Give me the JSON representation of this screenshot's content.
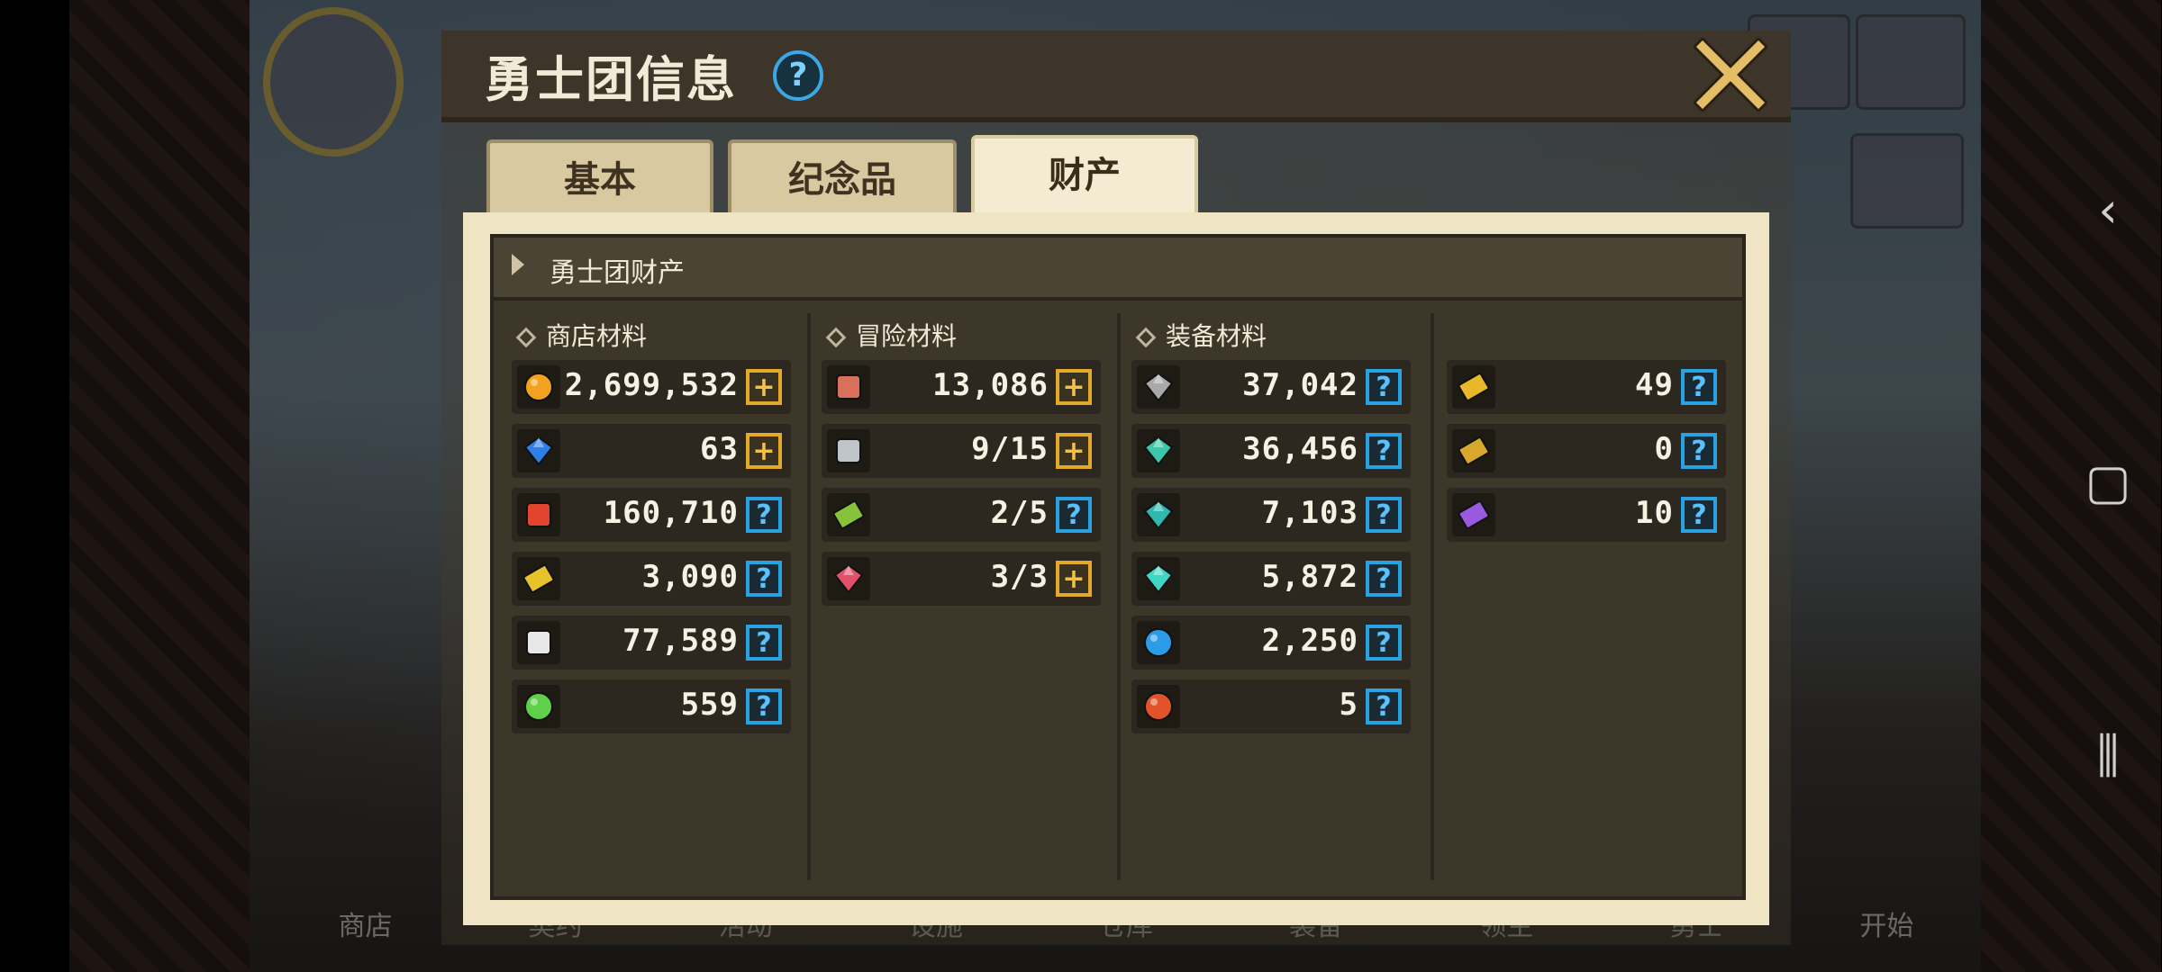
{
  "dialog": {
    "title": "勇士团信息",
    "help_glyph": "?",
    "close_icon": "close-icon"
  },
  "tabs": [
    {
      "label": "基本",
      "active": false
    },
    {
      "label": "纪念品",
      "active": false
    },
    {
      "label": "财产",
      "active": true
    }
  ],
  "panel": {
    "title": "勇士团财产"
  },
  "columns": [
    {
      "title": "商店材料",
      "items": [
        {
          "icon": "gold-coin-icon",
          "color": "#f2a21e",
          "value": "2,699,532",
          "action": "plus"
        },
        {
          "icon": "blue-gem-icon",
          "color": "#2f7fe8",
          "value": "63",
          "action": "plus"
        },
        {
          "icon": "star-medal-icon",
          "color": "#e2442e",
          "value": "160,710",
          "action": "help"
        },
        {
          "icon": "gold-ticket-icon",
          "color": "#e8c22a",
          "value": "3,090",
          "action": "help"
        },
        {
          "icon": "fish-bone-icon",
          "color": "#e8e8e8",
          "value": "77,589",
          "action": "help"
        },
        {
          "icon": "green-orb-icon",
          "color": "#5fd04a",
          "value": "559",
          "action": "help"
        }
      ]
    },
    {
      "title": "冒险材料",
      "items": [
        {
          "icon": "meat-icon",
          "color": "#d8705a",
          "value": "13,086",
          "action": "plus"
        },
        {
          "icon": "key-icon",
          "color": "#bfc4c8",
          "value": "9/15",
          "action": "plus"
        },
        {
          "icon": "green-ticket-icon",
          "color": "#86c23a",
          "value": "2/5",
          "action": "help"
        },
        {
          "icon": "red-crystal-icon",
          "color": "#e2506a",
          "value": "3/3",
          "action": "plus"
        }
      ]
    },
    {
      "title": "装备材料",
      "items": [
        {
          "icon": "iron-ore-icon",
          "color": "#a9a9a9",
          "value": "37,042",
          "action": "help"
        },
        {
          "icon": "teal-ore-icon",
          "color": "#3bc7a8",
          "value": "36,456",
          "action": "help"
        },
        {
          "icon": "teal-crystal-icon",
          "color": "#2fb7b0",
          "value": "7,103",
          "action": "help"
        },
        {
          "icon": "teal-gem-icon",
          "color": "#3fd6c6",
          "value": "5,872",
          "action": "help"
        },
        {
          "icon": "blue-orb-icon",
          "color": "#2a9ce8",
          "value": "2,250",
          "action": "help"
        },
        {
          "icon": "red-orb-icon",
          "color": "#e2532a",
          "value": "5",
          "action": "help"
        }
      ]
    },
    {
      "title": "",
      "items": [
        {
          "icon": "gold-scroll-icon",
          "color": "#e8b82a",
          "value": "49",
          "action": "help"
        },
        {
          "icon": "gold-ticket-icon",
          "color": "#d8a82a",
          "value": "0",
          "action": "help"
        },
        {
          "icon": "purple-ticket-icon",
          "color": "#9a5ae0",
          "value": "10",
          "action": "help"
        }
      ]
    }
  ],
  "background": {
    "bottom_menu": [
      "商店",
      "契约",
      "活动",
      "设施",
      "仓库",
      "装备",
      "领主",
      "勇士",
      "开始"
    ]
  }
}
